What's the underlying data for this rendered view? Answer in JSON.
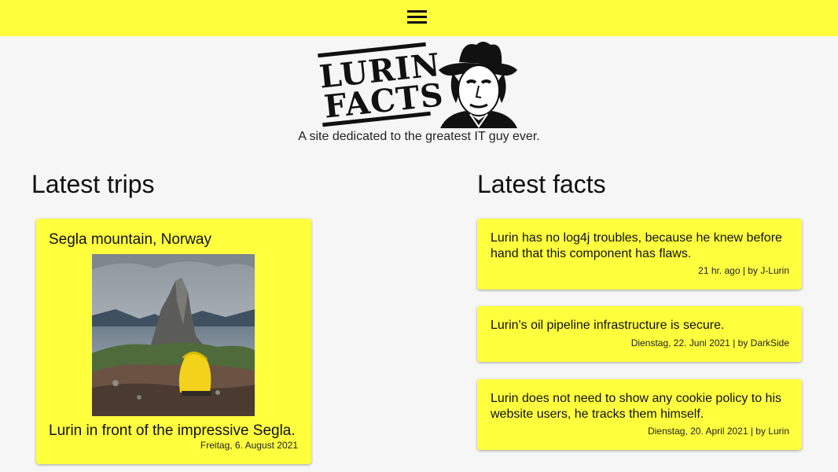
{
  "header": {
    "menu_icon": "hamburger-menu-icon"
  },
  "logo": {
    "line1": "LURIN",
    "line2": "FACTS",
    "portrait": "cowboy-hat-face-silhouette"
  },
  "tagline": "A site dedicated to the greatest IT guy ever.",
  "trips": {
    "heading": "Latest trips",
    "items": [
      {
        "title": "Segla mountain, Norway",
        "caption": "Lurin in front of the impressive Segla.",
        "date": "Freitag, 6. August 2021"
      }
    ]
  },
  "facts": {
    "heading": "Latest facts",
    "items": [
      {
        "text": "Lurin has no log4j troubles, because he knew before hand that this component has flaws.",
        "meta": "21 hr. ago | by J-Lurin"
      },
      {
        "text": "Lurin's oil pipeline infrastructure is secure.",
        "meta": "Dienstag, 22. Juni 2021 | by DarkSide"
      },
      {
        "text": "Lurin does not need to show any cookie policy to his website users, he tracks them himself.",
        "meta": "Dienstag, 20. April 2021 | by Lurin"
      }
    ]
  },
  "colors": {
    "accent": "#ffff3e",
    "background": "#f6f6f6",
    "text": "#111111"
  }
}
